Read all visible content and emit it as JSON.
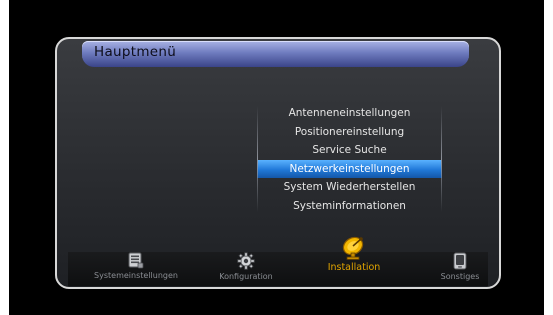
{
  "title": "Hauptmenü",
  "menu": {
    "items": [
      {
        "label": "Antenneneinstellungen"
      },
      {
        "label": "Positionereinstellung"
      },
      {
        "label": "Service Suche"
      },
      {
        "label": "Netzwerkeinstellungen",
        "selected": true
      },
      {
        "label": "System Wiederherstellen"
      },
      {
        "label": "Systeminformationen"
      }
    ]
  },
  "tabs": [
    {
      "label": "Systemeinstellungen",
      "icon": "list-icon"
    },
    {
      "label": "Konfiguration",
      "icon": "gear-icon"
    },
    {
      "label": "Installation",
      "icon": "satellite-dish-icon",
      "active": true
    },
    {
      "label": "Sonstiges",
      "icon": "device-icon"
    }
  ],
  "colors": {
    "accent": "#e0a400",
    "selection": "#2a86e6",
    "title_bar": "#6f7cbf"
  }
}
